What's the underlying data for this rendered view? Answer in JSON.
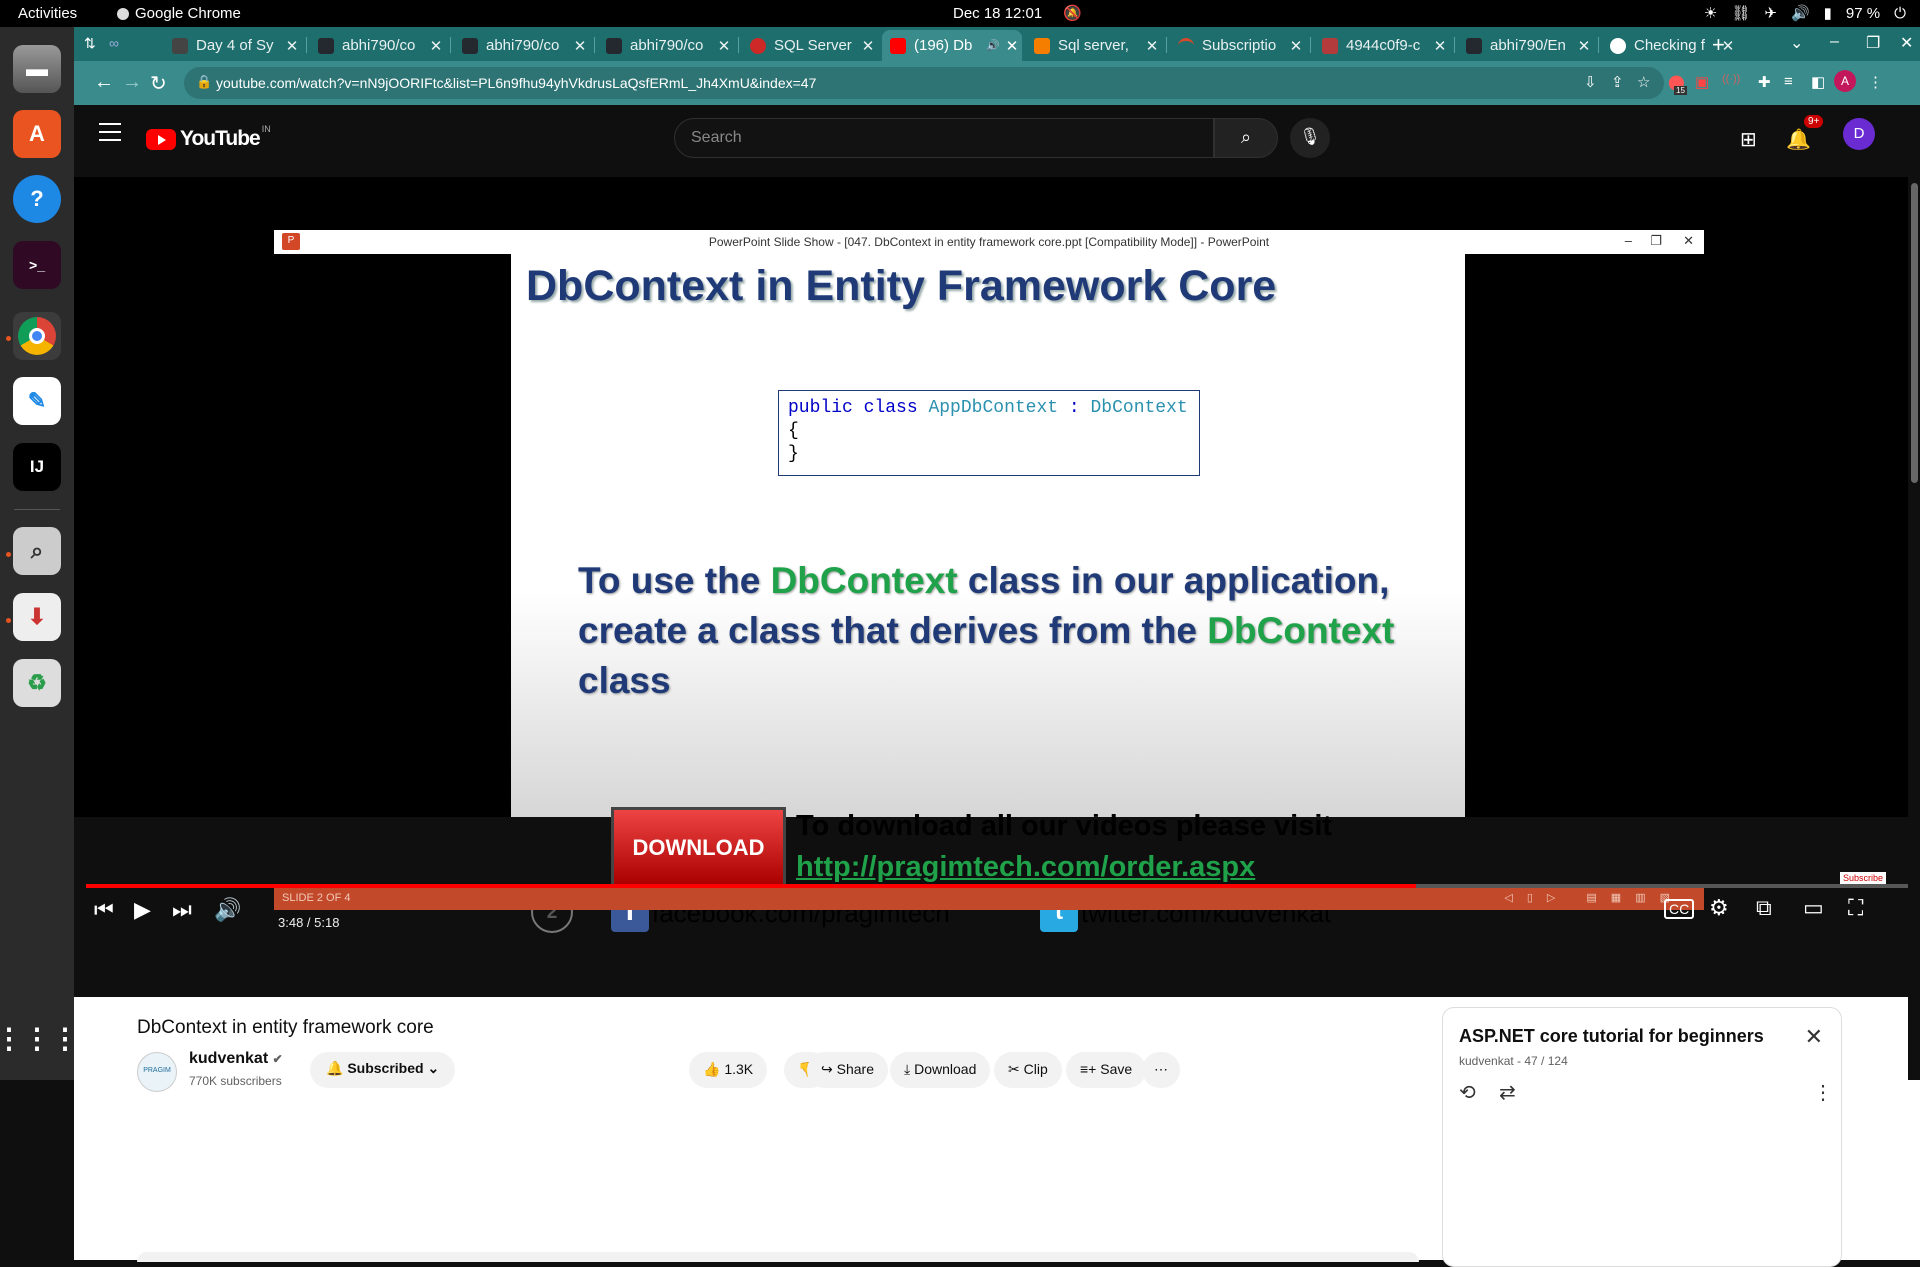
{
  "topbar": {
    "activities": "Activities",
    "app_name": "Google Chrome",
    "datetime": "Dec 18  12:01",
    "battery": "97 %"
  },
  "tabs": [
    {
      "label": "Day 4 of Sy",
      "color": "#444444"
    },
    {
      "label": "abhi790/co",
      "color": "#24292f"
    },
    {
      "label": "abhi790/co",
      "color": "#24292f"
    },
    {
      "label": "abhi790/co",
      "color": "#24292f"
    },
    {
      "label": "SQL Server",
      "color": "#cc2927"
    },
    {
      "label": "(196) Db",
      "color": "#ff0000"
    },
    {
      "label": "Sql server,",
      "color": "#f57d00"
    },
    {
      "label": "Subscriptio",
      "color": "#d44a2a"
    },
    {
      "label": "4944c0f9-c",
      "color": "#b33b3b"
    },
    {
      "label": "abhi790/En",
      "color": "#24292f"
    },
    {
      "label": "Checking f",
      "color": "#ffffff"
    }
  ],
  "toolbar": {
    "url": "youtube.com/watch?v=nN9jOORIFtc&list=PL6n9fhu94yhVkdrusLaQsfERmL_Jh4XmU&index=47",
    "ext_badge": "15"
  },
  "youtube": {
    "logo_text": "YouTube",
    "country": "IN",
    "search_placeholder": "Search",
    "notif_badge": "9+",
    "avatar_letter": "D"
  },
  "ppt": {
    "window_title": "PowerPoint Slide Show - [047. DbContext in entity framework core.ppt [Compatibility Mode]] - PowerPoint",
    "slide_title": "DbContext in Entity Framework Core",
    "code_kw1": "public",
    "code_kw2": "class",
    "code_class": "AppDbContext",
    "code_colon": " : ",
    "code_base": "DbContext",
    "code_open": "{",
    "code_close": "}",
    "body_a": "To use the ",
    "body_b": "DbContext",
    "body_c": " class in our application, create a class that derives from the ",
    "body_d": "DbContext",
    "body_e": " class",
    "download_btn": "DOWNLOAD",
    "download_text": "To download all our videos please visit",
    "download_url": "http://pragimtech.com/order.aspx",
    "slide_number": "2",
    "facebook": "facebook.com/pragimtech",
    "twitter": "twitter.com/kudvenkat",
    "slide_counter": "SLIDE 2 OF 4"
  },
  "player": {
    "time": "3:48 / 5:18",
    "progress": 0.73,
    "subscribe_watermark": "Subscribe"
  },
  "video": {
    "title": "DbContext in entity framework core",
    "channel": "kudvenkat",
    "channel_avatar_text": "PRAGIM",
    "subscribers": "770K subscribers",
    "subscribed_label": "Subscribed",
    "likes": "1.3K",
    "share": "Share",
    "download": "Download",
    "clip": "Clip",
    "save": "Save"
  },
  "playlist": {
    "title": "ASP.NET core tutorial for beginners",
    "meta": "kudvenkat - 47 / 124"
  }
}
